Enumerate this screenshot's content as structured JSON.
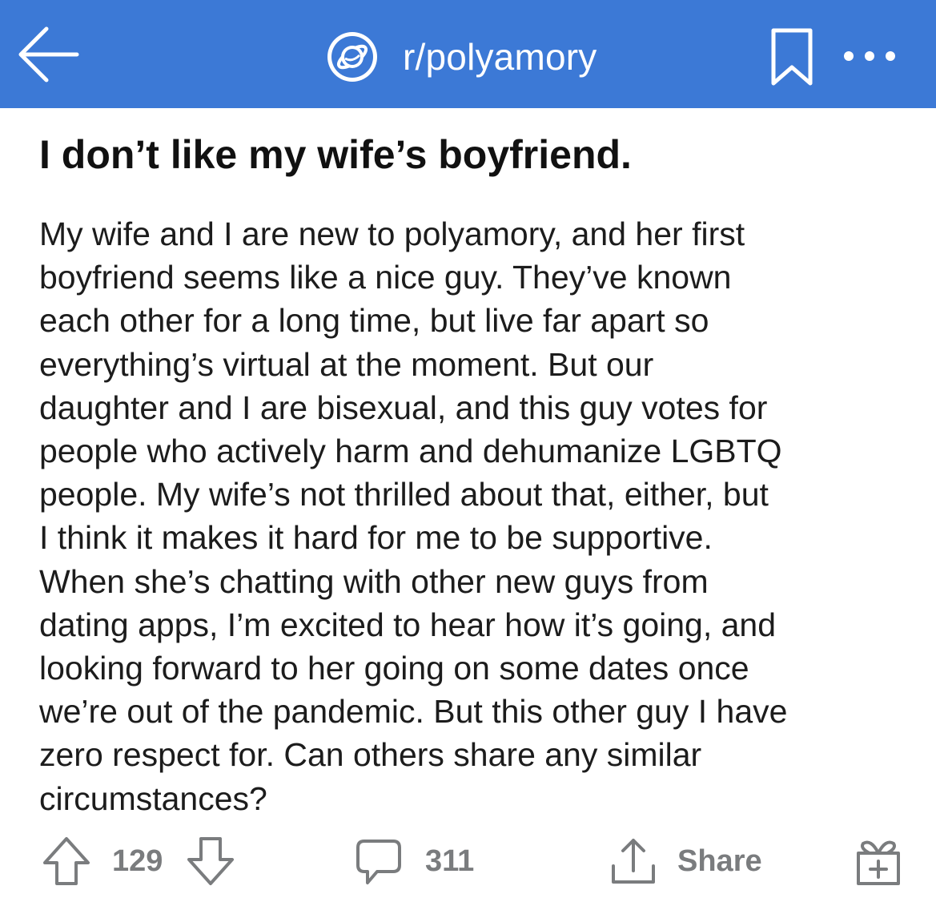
{
  "header": {
    "subreddit": "r/polyamory",
    "bg_color": "#3c79d6",
    "icons": {
      "back": "back-arrow-icon",
      "community": "planet-icon",
      "save": "bookmark-icon",
      "more": "more-dots-icon"
    }
  },
  "post": {
    "title": "I don’t like my wife’s boyfriend.",
    "body_lines": [
      "My wife and I are new to polyamory, and her first",
      "boyfriend seems like a nice guy.  They’ve known",
      "each other for a long time, but live far apart so",
      "everything’s virtual at the moment.  But our",
      "daughter and I are bisexual, and this guy votes for",
      "people who actively harm and dehumanize LGBTQ",
      "people.  My wife’s not thrilled about that, either, but",
      "I think it makes it hard for me to be supportive.",
      "When she’s chatting with other new guys from",
      "dating apps, I’m excited to hear how it’s going, and",
      "looking forward to her going on some dates once",
      "we’re out of the pandemic.  But this other guy I have",
      "zero respect for.  Can others share any similar",
      "circumstances?"
    ]
  },
  "actions": {
    "score": "129",
    "comments": "311",
    "share_label": "Share",
    "icon_color": "#7a7c7e",
    "icons": {
      "upvote": "upvote-arrow-icon",
      "downvote": "downvote-arrow-icon",
      "comment": "comment-bubble-icon",
      "share": "share-icon",
      "award": "gift-award-icon"
    }
  }
}
